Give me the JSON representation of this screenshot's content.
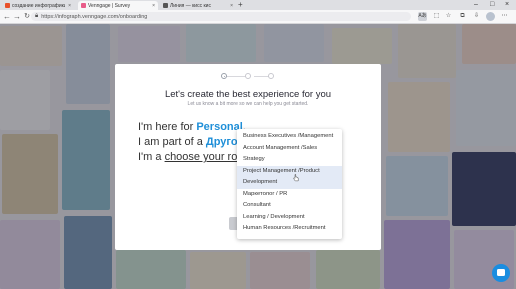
{
  "browser": {
    "tabs": [
      {
        "title": "создание инфографики онлайн",
        "favicon_color": "#e8502a",
        "active": false
      },
      {
        "title": "Venngage | Survey",
        "favicon_color": "#e85c8a",
        "active": true
      },
      {
        "title": "Линия — кисс кис",
        "favicon_color": "#555555",
        "active": false
      }
    ],
    "url": "https://infograph.venngage.com/onboarding",
    "translate_badge": "Aあ"
  },
  "modal": {
    "title": "Let's create the best experience for you",
    "subtitle": "Let us know a bit more so we can help you get started.",
    "line1_prefix": "I'm here for ",
    "line1_value": "Personal",
    "line1_suffix": ".",
    "line2_prefix": "I am part of a ",
    "line2_value": "Другое",
    "line2_suffix": " o",
    "line3_prefix": "I'm a ",
    "line3_value": "choose your role",
    "line3_suffix": "."
  },
  "dropdown": {
    "options": [
      "Business Executives /Management",
      "Account Management /Sales",
      "Strategy",
      "Project Management /Product",
      "Development",
      "Маркетолог / PR",
      "Consultant",
      "Learning / Development",
      "Human Resources /Recruitment"
    ],
    "hovered": "Project Management /Product"
  },
  "colors": {
    "accent": "#1f8fd8",
    "chat": "#1a8de0",
    "hover_bg": "#e3eaf6"
  }
}
